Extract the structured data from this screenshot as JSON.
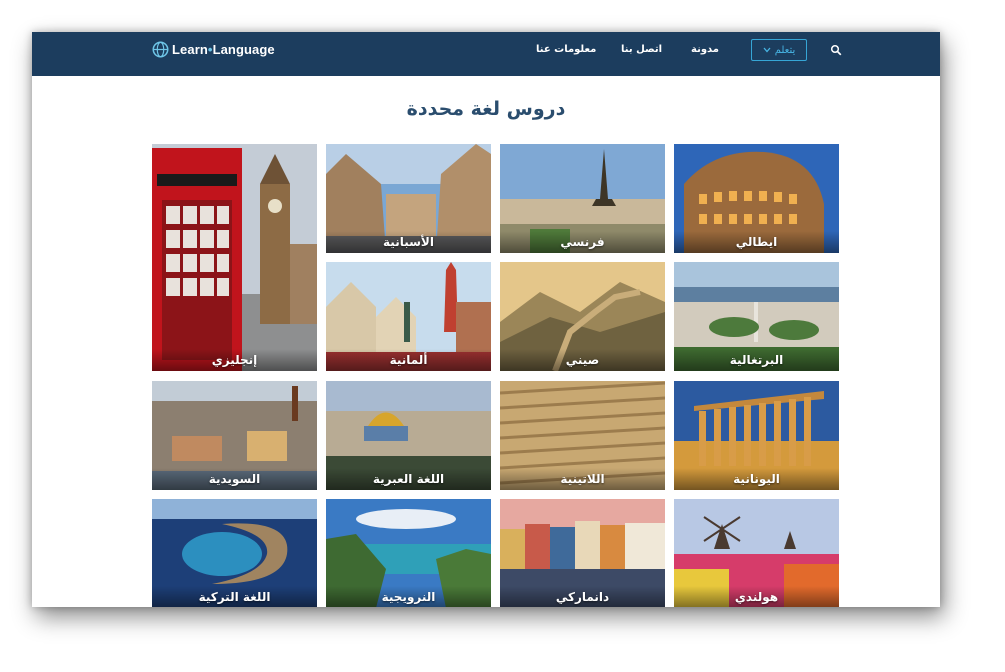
{
  "header": {
    "logo_left": "Learn",
    "logo_dot": "•",
    "logo_right": "Language",
    "nav": {
      "about": "معلومات عنا",
      "contact": "اتصل بنا",
      "blog": "مدونة",
      "learn_button": "يتعلم"
    },
    "icons": {
      "logo": "globe-icon",
      "dropdown": "chevron-down-icon",
      "search": "search-icon"
    }
  },
  "main": {
    "heading": "دروس لغة محددة"
  },
  "tiles": [
    {
      "label": "إنجليزي",
      "scene": "london"
    },
    {
      "label": "الأسبانية",
      "scene": "madrid"
    },
    {
      "label": "فرنسي",
      "scene": "paris"
    },
    {
      "label": "ايطالي",
      "scene": "rome"
    },
    {
      "label": "ألمانية",
      "scene": "german-town"
    },
    {
      "label": "صيني",
      "scene": "great-wall"
    },
    {
      "label": "البرتغالية",
      "scene": "lisbon"
    },
    {
      "label": "السويدية",
      "scene": "stockholm"
    },
    {
      "label": "اللغة العبرية",
      "scene": "jerusalem"
    },
    {
      "label": "اللاتينية",
      "scene": "latin-inscription"
    },
    {
      "label": "اليونانية",
      "scene": "greek-temple"
    },
    {
      "label": "اللغة التركية",
      "scene": "crescent-island"
    },
    {
      "label": "النرويجية",
      "scene": "fjord"
    },
    {
      "label": "دانماركي",
      "scene": "copenhagen"
    },
    {
      "label": "هولندي",
      "scene": "windmills-tulips"
    }
  ],
  "colors": {
    "nav_background": "#1c3d5e",
    "accent": "#36a6d6",
    "heading": "#2a4d6e"
  }
}
